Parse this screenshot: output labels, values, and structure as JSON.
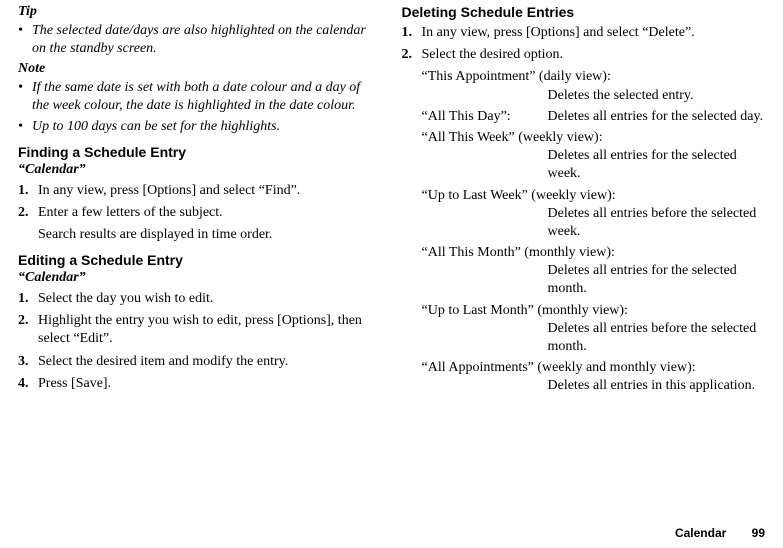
{
  "left": {
    "tip_label": "Tip",
    "tip_text": "The selected date/days are also highlighted on the calendar on the standby screen.",
    "note_label": "Note",
    "note_items": [
      "If the same date is set with both a date colour and a day of the week colour, the date is highlighted in the date colour.",
      "Up to 100 days can be set for the highlights."
    ],
    "finding": {
      "heading": "Finding a Schedule Entry",
      "sub": "“Calendar”",
      "steps": [
        {
          "n": "1.",
          "text": "In any view, press [Options] and select “Find”."
        },
        {
          "n": "2.",
          "text": "Enter a few letters of the subject.",
          "sub": "Search results are displayed in time order."
        }
      ]
    },
    "editing": {
      "heading": "Editing a Schedule Entry",
      "sub": "“Calendar”",
      "steps": [
        {
          "n": "1.",
          "text": "Select the day you wish to edit."
        },
        {
          "n": "2.",
          "text": "Highlight the entry you wish to edit, press [Options], then select “Edit”."
        },
        {
          "n": "3.",
          "text": "Select the desired item and modify the entry."
        },
        {
          "n": "4.",
          "text": "Press [Save]."
        }
      ]
    }
  },
  "right": {
    "heading": "Deleting Schedule Entries",
    "steps": [
      {
        "n": "1.",
        "text": "In any view, press [Options] and select “Delete”."
      },
      {
        "n": "2.",
        "text": "Select the desired option."
      }
    ],
    "options": [
      {
        "term": "“This Appointment” (daily view):",
        "desc": "Deletes the selected entry.",
        "wrap": true
      },
      {
        "term": "“All This Day”:",
        "desc": "Deletes all entries for the selected day.",
        "wrap": false
      },
      {
        "term": "“All This Week” (weekly view):",
        "desc": "Deletes all entries for the selected week.",
        "wrap": true
      },
      {
        "term": "“Up to Last Week” (weekly view):",
        "desc": "Deletes all entries before the selected week.",
        "wrap": true
      },
      {
        "term": "“All This Month” (monthly view):",
        "desc": "Deletes all entries for the selected month.",
        "wrap": true
      },
      {
        "term": "“Up to Last Month” (monthly view):",
        "desc": "Deletes all entries before the selected month.",
        "wrap": true
      },
      {
        "term": "“All Appointments” (weekly and monthly view):",
        "desc": "Deletes all entries in this application.",
        "wrap": true
      }
    ]
  },
  "footer": {
    "section": "Calendar",
    "page": "99"
  }
}
